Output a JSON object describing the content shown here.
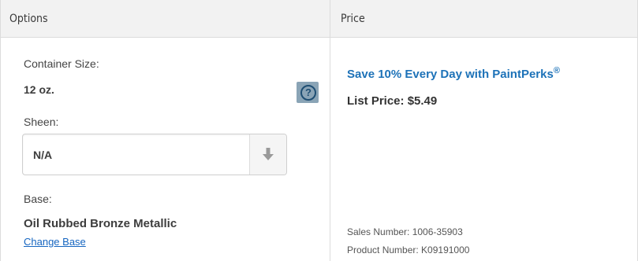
{
  "header": {
    "options_label": "Options",
    "price_label": "Price"
  },
  "options": {
    "container_size_label": "Container Size:",
    "container_size_value": "12 oz.",
    "help_icon": "question-circle-icon",
    "help_symbol": "?",
    "sheen_label": "Sheen:",
    "sheen_selected": "N/A",
    "sheen_dropdown_icon": "arrow-down-icon",
    "base_label": "Base:",
    "base_value": "Oil Rubbed Bronze Metallic",
    "change_base_link": "Change Base"
  },
  "price": {
    "promo_text": "Save 10% Every Day with PaintPerks",
    "promo_mark": "®",
    "list_price": "List Price: $5.49",
    "sales_number": "Sales Number: 1006-35903",
    "product_number": "Product Number: K09191000"
  },
  "colors": {
    "promo": "#1d72b8",
    "link": "#1565c0",
    "help_bg": "#8aa4b6",
    "header_bg": "#f2f2f2"
  }
}
